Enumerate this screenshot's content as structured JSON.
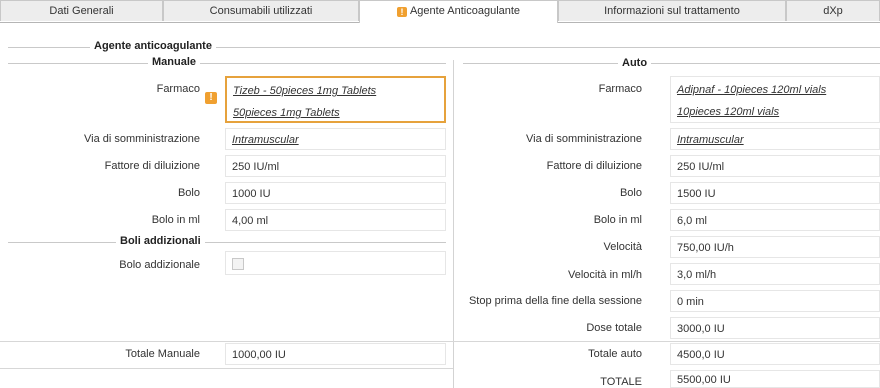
{
  "tabs": [
    {
      "label": "Dati Generali"
    },
    {
      "label": "Consumabili utilizzati"
    },
    {
      "label": "Agente Anticoagulante",
      "warning": "!"
    },
    {
      "label": "Informazioni sul trattamento"
    },
    {
      "label": "dXp"
    }
  ],
  "section": {
    "title": "Agente anticoagulante"
  },
  "manual": {
    "title": "Manuale",
    "farmaco_label": "Farmaco",
    "farmaco_line1": "Tizeb - 50pieces 1mg Tablets",
    "farmaco_line2": "50pieces 1mg Tablets",
    "via_label": "Via di somministrazione",
    "via_value": "Intramuscular",
    "fattore_label": "Fattore di diluizione",
    "fattore_value": "250 IU/ml",
    "bolo_label": "Bolo",
    "bolo_value": "1000 IU",
    "bolo_ml_label": "Bolo in ml",
    "bolo_ml_value": "4,00 ml",
    "boli_title": "Boli addizionali",
    "bolo_add_label": "Bolo addizionale",
    "totale_label": "Totale Manuale",
    "totale_value": "1000,00 IU"
  },
  "auto": {
    "title": "Auto",
    "farmaco_label": "Farmaco",
    "farmaco_line1": "Adipnaf - 10pieces 120ml vials",
    "farmaco_line2": "10pieces 120ml vials",
    "via_label": "Via di somministrazione",
    "via_value": "Intramuscular",
    "fattore_label": "Fattore di diluizione",
    "fattore_value": "250 IU/ml",
    "bolo_label": "Bolo",
    "bolo_value": "1500 IU",
    "bolo_ml_label": "Bolo in ml",
    "bolo_ml_value": "6,0 ml",
    "velocita_label": "Velocità",
    "velocita_value": "750,00 IU/h",
    "velocita_ml_label": "Velocità in ml/h",
    "velocita_ml_value": "3,0 ml/h",
    "stop_label": "Stop prima della fine della sessione",
    "stop_value": "0 min",
    "dose_label": "Dose totale",
    "dose_value": "3000,0 IU",
    "totale_label": "Totale auto",
    "totale_value": "4500,0 IU",
    "grand_label": "TOTALE",
    "grand_value": "5500,00 IU"
  },
  "icons": {
    "warning": "warning-icon",
    "warning_color": "#f0a030",
    "highlight_color": "#e6a23c"
  }
}
